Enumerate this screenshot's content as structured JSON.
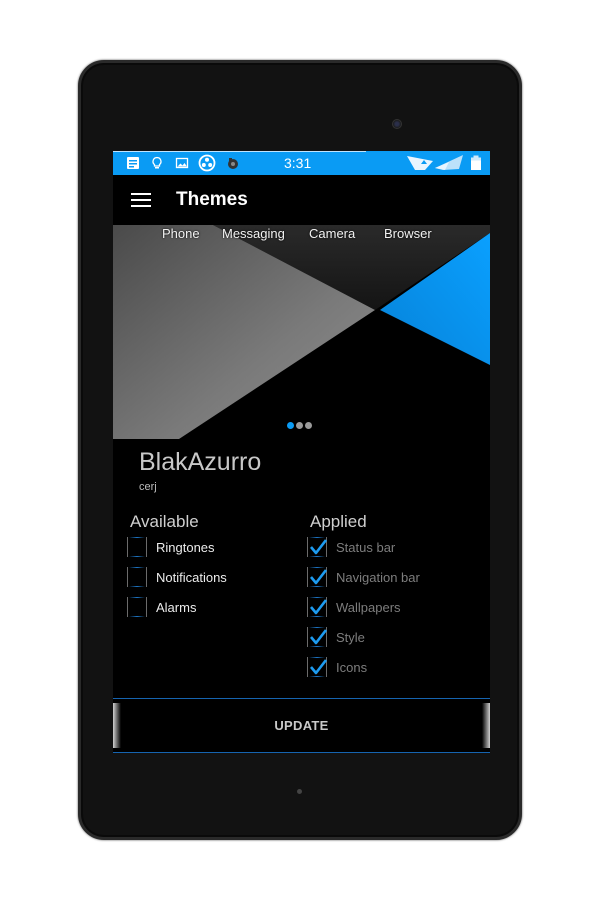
{
  "statusbar": {
    "time": "3:31",
    "icons": [
      "notes-icon",
      "lightbulb-icon",
      "image-icon",
      "community-icon",
      "camera-app-icon",
      "wifi-signal-icon",
      "battery-icon"
    ],
    "color": "#0a9bf4"
  },
  "appbar": {
    "title": "Themes",
    "menu_icon": "hamburger-menu-icon"
  },
  "preview": {
    "tabs": [
      {
        "label": "Phone"
      },
      {
        "label": "Messaging"
      },
      {
        "label": "Camera"
      },
      {
        "label": "Browser"
      }
    ],
    "page_count": 3,
    "active_page": 1
  },
  "theme": {
    "name": "BlakAzurro",
    "author": "cerj"
  },
  "available": {
    "heading": "Available",
    "items": [
      {
        "label": "Ringtones",
        "checked": false
      },
      {
        "label": "Notifications",
        "checked": false
      },
      {
        "label": "Alarms",
        "checked": false
      }
    ]
  },
  "applied": {
    "heading": "Applied",
    "items": [
      {
        "label": "Status bar",
        "checked": true
      },
      {
        "label": "Navigation bar",
        "checked": true
      },
      {
        "label": "Wallpapers",
        "checked": true
      },
      {
        "label": "Style",
        "checked": true
      },
      {
        "label": "Icons",
        "checked": true
      }
    ]
  },
  "update_button": {
    "label": "UPDATE"
  },
  "colors": {
    "accent": "#0a9bf4",
    "background": "#000000",
    "bezel": "#121212"
  }
}
